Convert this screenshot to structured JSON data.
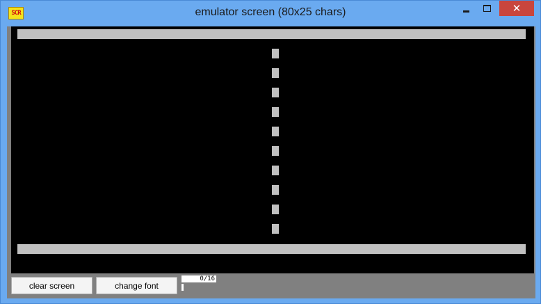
{
  "window": {
    "title": "emulator screen (80x25 chars)",
    "icon_label": "SCR",
    "minimize_glyph": "",
    "close_glyph": "✕"
  },
  "screen": {
    "background": "#000000",
    "foreground": "#c0c0c0",
    "dash_count": 10
  },
  "controls": {
    "clear_label": "clear screen",
    "font_label": "change font",
    "counter": "0/16"
  }
}
